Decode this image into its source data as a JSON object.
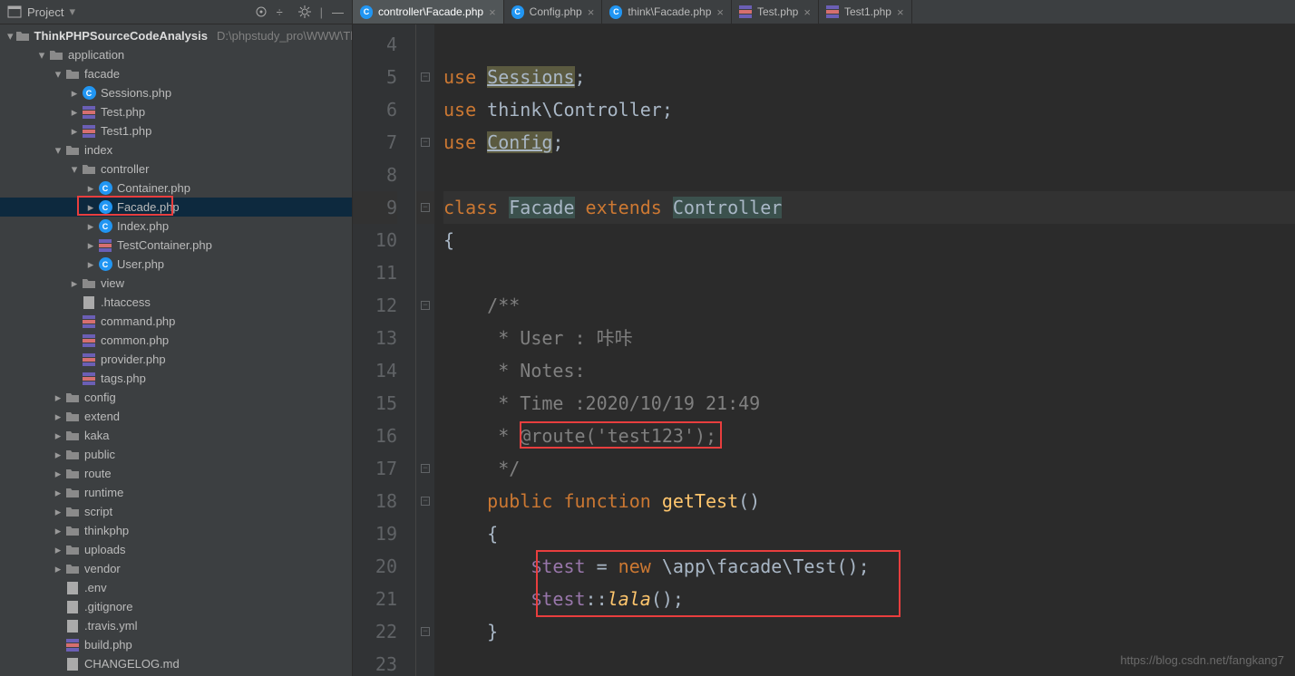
{
  "sidebar": {
    "title": "Project",
    "root": {
      "name": "ThinkPHPSourceCodeAnalysis",
      "path": "D:\\phpstudy_pro\\WWW\\Th"
    },
    "items": [
      {
        "level": 1,
        "chev": "down",
        "icon": "folder",
        "label": "application"
      },
      {
        "level": 2,
        "chev": "down",
        "icon": "folder",
        "label": "facade"
      },
      {
        "level": 3,
        "chev": "right",
        "icon": "php",
        "label": "Sessions.php"
      },
      {
        "level": 3,
        "chev": "right",
        "icon": "php-p",
        "label": "Test.php"
      },
      {
        "level": 3,
        "chev": "right",
        "icon": "php-p",
        "label": "Test1.php"
      },
      {
        "level": 2,
        "chev": "down",
        "icon": "folder",
        "label": "index"
      },
      {
        "level": 3,
        "chev": "down",
        "icon": "folder",
        "label": "controller"
      },
      {
        "level": 4,
        "chev": "right",
        "icon": "php",
        "label": "Container.php"
      },
      {
        "level": 4,
        "chev": "right",
        "icon": "php",
        "label": "Facade.php",
        "selected": true
      },
      {
        "level": 4,
        "chev": "right",
        "icon": "php",
        "label": "Index.php"
      },
      {
        "level": 4,
        "chev": "right",
        "icon": "php-p",
        "label": "TestContainer.php"
      },
      {
        "level": 4,
        "chev": "right",
        "icon": "php",
        "label": "User.php"
      },
      {
        "level": 3,
        "chev": "right",
        "icon": "folder",
        "label": "view"
      },
      {
        "level": 3,
        "chev": "none",
        "icon": "file",
        "label": ".htaccess"
      },
      {
        "level": 3,
        "chev": "none",
        "icon": "php-p",
        "label": "command.php"
      },
      {
        "level": 3,
        "chev": "none",
        "icon": "php-p",
        "label": "common.php"
      },
      {
        "level": 3,
        "chev": "none",
        "icon": "php-p",
        "label": "provider.php"
      },
      {
        "level": 3,
        "chev": "none",
        "icon": "php-p",
        "label": "tags.php"
      },
      {
        "level": 2,
        "chev": "right",
        "icon": "folder",
        "label": "config"
      },
      {
        "level": 2,
        "chev": "right",
        "icon": "folder",
        "label": "extend"
      },
      {
        "level": 2,
        "chev": "right",
        "icon": "folder",
        "label": "kaka"
      },
      {
        "level": 2,
        "chev": "right",
        "icon": "folder",
        "label": "public"
      },
      {
        "level": 2,
        "chev": "right",
        "icon": "folder",
        "label": "route"
      },
      {
        "level": 2,
        "chev": "right",
        "icon": "folder",
        "label": "runtime"
      },
      {
        "level": 2,
        "chev": "right",
        "icon": "folder",
        "label": "script"
      },
      {
        "level": 2,
        "chev": "right",
        "icon": "folder",
        "label": "thinkphp"
      },
      {
        "level": 2,
        "chev": "right",
        "icon": "folder",
        "label": "uploads"
      },
      {
        "level": 2,
        "chev": "right",
        "icon": "folder",
        "label": "vendor"
      },
      {
        "level": 2,
        "chev": "none",
        "icon": "file",
        "label": ".env"
      },
      {
        "level": 2,
        "chev": "none",
        "icon": "file",
        "label": ".gitignore"
      },
      {
        "level": 2,
        "chev": "none",
        "icon": "file",
        "label": ".travis.yml"
      },
      {
        "level": 2,
        "chev": "none",
        "icon": "php-p",
        "label": "build.php"
      },
      {
        "level": 2,
        "chev": "none",
        "icon": "file",
        "label": "CHANGELOG.md"
      }
    ]
  },
  "tabs": [
    {
      "label": "controller\\Facade.php",
      "icon": "php",
      "active": true
    },
    {
      "label": "Config.php",
      "icon": "php"
    },
    {
      "label": "think\\Facade.php",
      "icon": "php"
    },
    {
      "label": "Test.php",
      "icon": "php-p"
    },
    {
      "label": "Test1.php",
      "icon": "php-p"
    }
  ],
  "code": {
    "l5_use": "use ",
    "l5_sessions": "Sessions",
    "l6_use": "use ",
    "l6_think": "think\\Controller;",
    "l7_use": "use ",
    "l7_config": "Config",
    "l9_class": "class ",
    "l9_facade": "Facade",
    "l9_extends": " extends ",
    "l9_controller": "Controller",
    "l10_brace": "{",
    "l12_cmt": "    /**",
    "l13_cmt": "     * User : 咔咔",
    "l14_cmt": "     * Notes:",
    "l15_cmt": "     * Time :2020/10/19 21:49",
    "l16_cmt_prefix": "     * ",
    "l16_route": "@route('test123');",
    "l17_cmt": "     */",
    "l18_public": "    public ",
    "l18_function": "function ",
    "l18_gettest": "getTest",
    "l18_paren": "()",
    "l19_brace": "    {",
    "l20_test": "        $test",
    "l20_eq": " = ",
    "l20_new": "new ",
    "l20_path": "\\app\\facade\\Test();",
    "l21_test": "        $test",
    "l21_dcolon": "::",
    "l21_lala": "lala",
    "l21_paren": "();",
    "l22_brace": "    }"
  },
  "watermark": "https://blog.csdn.net/fangkang7"
}
